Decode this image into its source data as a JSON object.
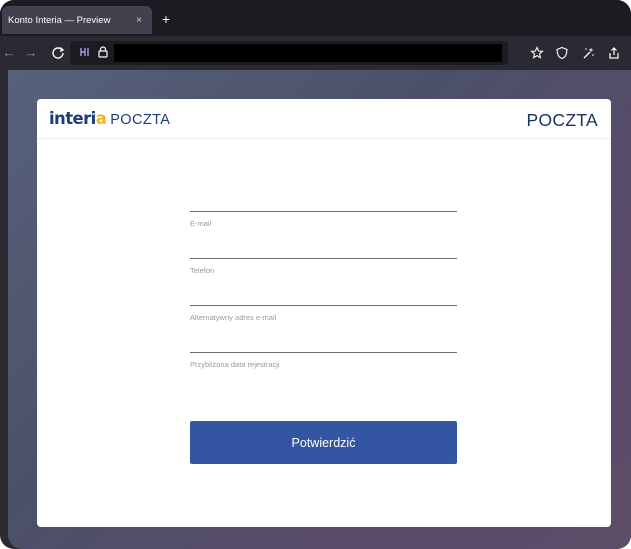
{
  "browser": {
    "tab_title": "Konto Interia — Preview",
    "tab_close": "×",
    "new_tab": "+",
    "nav": {
      "back_icon": "←",
      "forward_icon": "→",
      "reload_icon": "C"
    },
    "url_icon_label": "🔒",
    "toolbar_icons": [
      "bookmark-star-icon",
      "shield-icon",
      "magic-wand-icon",
      "share-icon"
    ]
  },
  "page": {
    "logo": {
      "brand": "interi",
      "brand_q": "a",
      "product": "POCZTA"
    },
    "header_right": "POCZTA",
    "fields": [
      {
        "label": "E-mail",
        "value": ""
      },
      {
        "label": "Telefon",
        "value": ""
      },
      {
        "label": "Alternatywny adres e-mail",
        "value": ""
      },
      {
        "label": "Przybliżona data rejestracji",
        "value": ""
      }
    ],
    "submit_label": "Potwierdzić"
  },
  "colors": {
    "brand_navy": "#1d3c80",
    "brand_yellow": "#f2b81b",
    "button": "#3355a3",
    "browser_chrome": "#2b2a33"
  }
}
